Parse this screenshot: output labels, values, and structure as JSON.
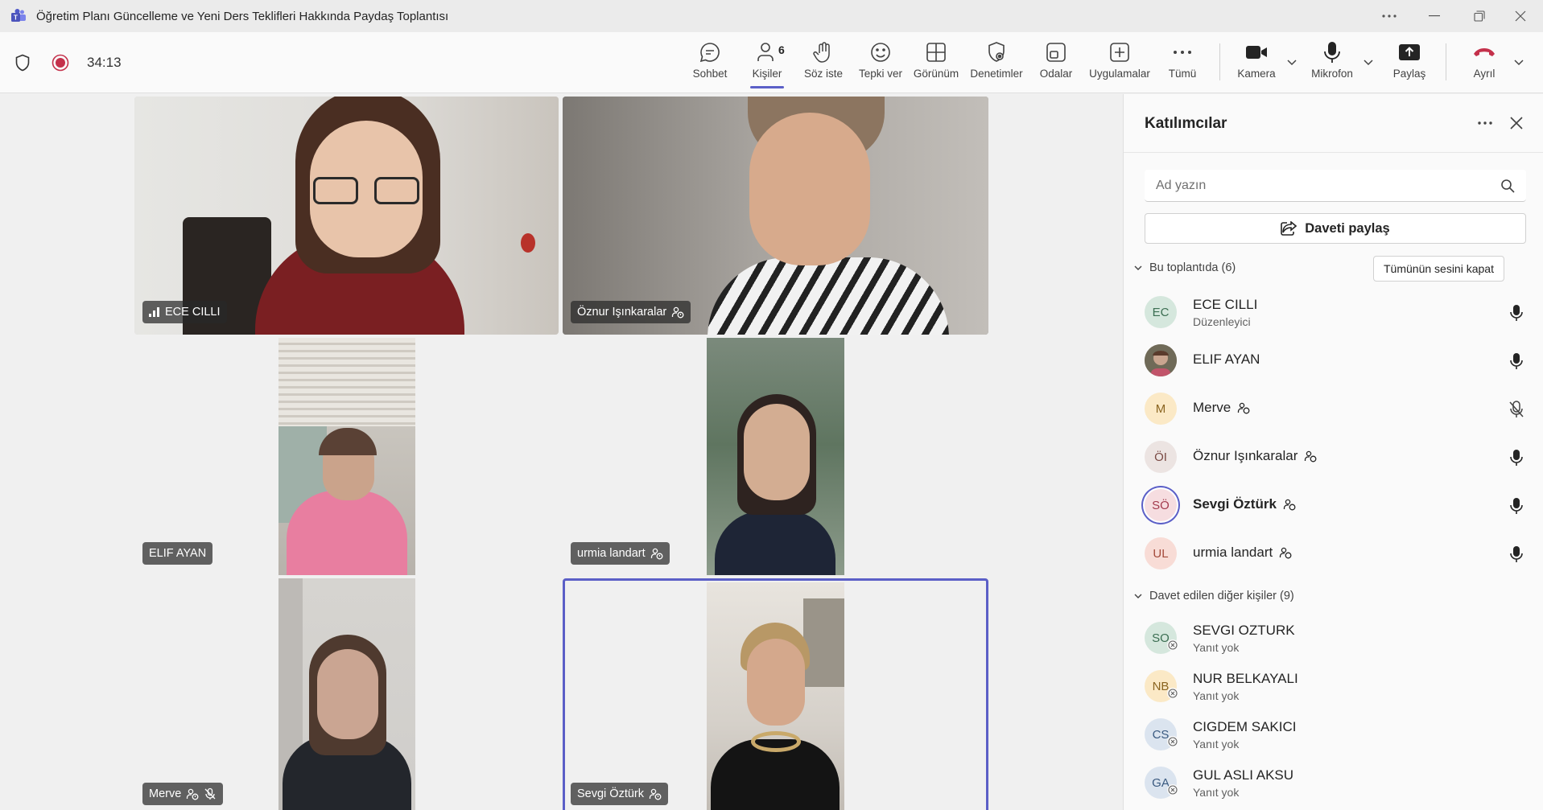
{
  "window": {
    "title": "Öğretim Planı Güncelleme ve Yeni Ders Teklifleri Hakkında Paydaş Toplantısı"
  },
  "toolbar": {
    "timer": "34:13",
    "chat": "Sohbet",
    "people": "Kişiler",
    "people_count": "6",
    "raise": "Söz iste",
    "react": "Tepki ver",
    "view": "Görünüm",
    "controls": "Denetimler",
    "rooms": "Odalar",
    "apps": "Uygulamalar",
    "more": "Tümü",
    "camera": "Kamera",
    "mic": "Mikrofon",
    "share": "Paylaş",
    "leave": "Ayrıl"
  },
  "tiles": [
    {
      "name": "ECE CILLI"
    },
    {
      "name": "Öznur Işınkaralar"
    },
    {
      "name": "ELIF AYAN"
    },
    {
      "name": "urmia landart"
    },
    {
      "name": "Merve"
    },
    {
      "name": "Sevgi Öztürk"
    }
  ],
  "panel": {
    "title": "Katılımcılar",
    "search_placeholder": "Ad yazın",
    "invite_label": "Daveti paylaş",
    "in_meeting_header": "Bu toplantıda (6)",
    "mute_all": "Tümünün sesini kapat",
    "invited_header": "Davet edilen diğer kişiler (9)",
    "in_meeting": [
      {
        "initials": "EC",
        "name": "ECE CILLI",
        "sub": "Düzenleyici"
      },
      {
        "initials": "",
        "name": "ELIF AYAN",
        "sub": ""
      },
      {
        "initials": "M",
        "name": "Merve",
        "sub": ""
      },
      {
        "initials": "ÖI",
        "name": "Öznur Işınkaralar",
        "sub": ""
      },
      {
        "initials": "SÖ",
        "name": "Sevgi Öztürk",
        "sub": ""
      },
      {
        "initials": "UL",
        "name": "urmia landart",
        "sub": ""
      }
    ],
    "invited": [
      {
        "initials": "SO",
        "name": "SEVGI OZTURK",
        "sub": "Yanıt yok"
      },
      {
        "initials": "NB",
        "name": "NUR BELKAYALI",
        "sub": "Yanıt yok"
      },
      {
        "initials": "CS",
        "name": "CIGDEM SAKICI",
        "sub": "Yanıt yok"
      },
      {
        "initials": "GA",
        "name": "GUL ASLI AKSU",
        "sub": "Yanıt yok"
      }
    ]
  },
  "colors": {
    "accent": "#5b5fc7",
    "leave_red": "#c4314b",
    "record_red": "#c4314b"
  }
}
